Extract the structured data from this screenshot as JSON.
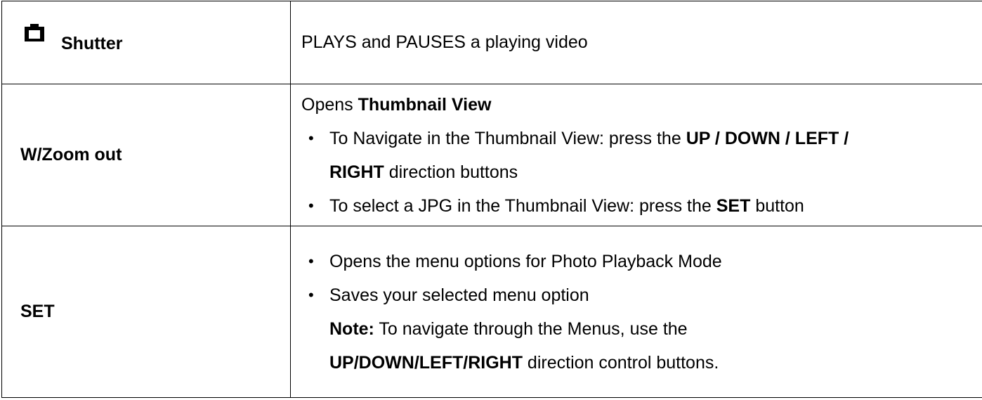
{
  "rows": [
    {
      "key": "Shutter",
      "icon": "camera-icon",
      "desc": "PLAYS and PAUSES a playing video"
    },
    {
      "key": "W/Zoom out",
      "heading_text": "Opens ",
      "heading_bold": "Thumbnail View",
      "bullet1": {
        "text1": "To Navigate in the Thumbnail View: press the ",
        "bold1": "UP / DOWN / LEFT /",
        "bold2": "RIGHT",
        "text2": " direction buttons"
      },
      "bullet2": {
        "text1": "To select a JPG in the Thumbnail View: press the ",
        "bold1": "SET",
        "text2": " button"
      }
    },
    {
      "key": "SET",
      "bullet1": "Opens the menu options for Photo Playback Mode",
      "bullet2": "Saves your selected menu option",
      "note_label": "Note:",
      "note_text": " To navigate through the Menus, use the",
      "note_bold": "UP/DOWN/LEFT/RIGHT",
      "note_text2": " direction control buttons."
    }
  ],
  "bullet_glyph": "•"
}
